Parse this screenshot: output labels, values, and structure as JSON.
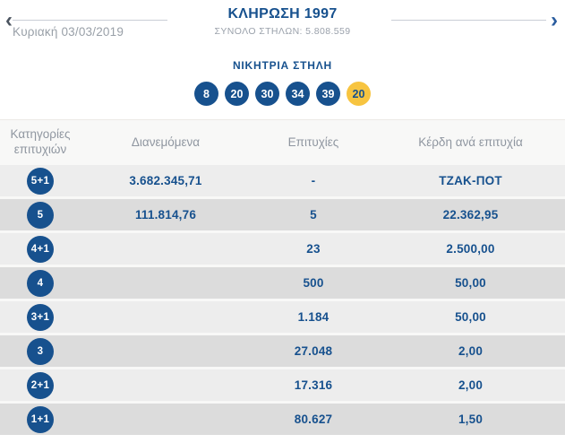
{
  "colors": {
    "blue": "#17518e",
    "yellow": "#f7c440",
    "row_light": "#ededed",
    "row_dark": "#dcdcdc"
  },
  "icons": {
    "chevron_left": "‹",
    "chevron_right": "›"
  },
  "header": {
    "title": "ΚΛΗΡΩΣΗ 1997",
    "total_columns": "ΣΥΝΟΛΟ ΣΤΗΛΩΝ: 5.808.559",
    "date": "Κυριακή 03/03/2019"
  },
  "winning": {
    "title": "ΝΙΚΗΤΡΙΑ ΣΤΗΛΗ",
    "numbers": [
      "8",
      "20",
      "30",
      "34",
      "39"
    ],
    "joker": "20"
  },
  "table": {
    "headers": [
      "Κατηγορίες επιτυχιών",
      "Διανεμόμενα",
      "Επιτυχίες",
      "Κέρδη ανά επιτυχία"
    ],
    "rows": [
      {
        "category": "5+1",
        "distributed": "3.682.345,71",
        "wins": "-",
        "prize": "ΤΖΑΚ-ΠΟΤ"
      },
      {
        "category": "5",
        "distributed": "111.814,76",
        "wins": "5",
        "prize": "22.362,95"
      },
      {
        "category": "4+1",
        "distributed": "",
        "wins": "23",
        "prize": "2.500,00"
      },
      {
        "category": "4",
        "distributed": "",
        "wins": "500",
        "prize": "50,00"
      },
      {
        "category": "3+1",
        "distributed": "",
        "wins": "1.184",
        "prize": "50,00"
      },
      {
        "category": "3",
        "distributed": "",
        "wins": "27.048",
        "prize": "2,00"
      },
      {
        "category": "2+1",
        "distributed": "",
        "wins": "17.316",
        "prize": "2,00"
      },
      {
        "category": "1+1",
        "distributed": "",
        "wins": "80.627",
        "prize": "1,50"
      }
    ]
  }
}
